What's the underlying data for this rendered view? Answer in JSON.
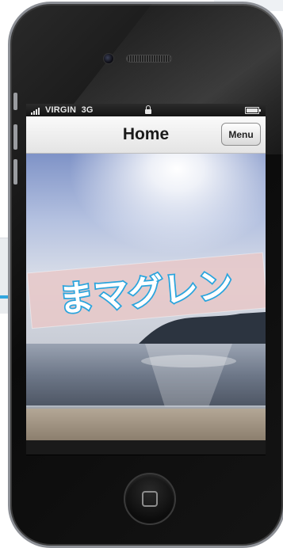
{
  "status_bar": {
    "carrier": "VIRGIN",
    "network": "3G"
  },
  "nav": {
    "title": "Home",
    "menu_label": "Menu"
  },
  "hero": {
    "logo_text": "まマグレン",
    "description_icon": "beach-scene"
  },
  "colors": {
    "logo_blue": "#2aa4dd",
    "nav_text": "#1a1a1a"
  }
}
